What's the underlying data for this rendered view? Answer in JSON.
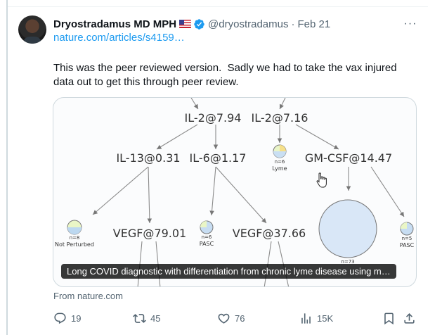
{
  "tweet": {
    "author_name": "Dryostradamus MD MPH",
    "handle": "@dryostradamus",
    "separator": "·",
    "date": "Feb 21",
    "link": "nature.com/articles/s4159…",
    "text": "This was the peer reviewed version.  Sadly we had to take the vax injured data out to get this through peer review.",
    "more_icon": "···"
  },
  "card": {
    "caption": "Long COVID diagnostic with differentiation from chronic lyme disease using m…",
    "source": "From nature.com",
    "diagram": {
      "nodes": {
        "il2_a": "IL-2@7.94",
        "il2_b": "IL-2@7.16",
        "il13": "IL-13@0.31",
        "il6": "IL-6@1.17",
        "gmcsf": "GM-CSF@14.47",
        "vegf_a": "VEGF@79.01",
        "vegf_b": "VEGF@37.66"
      },
      "leaves": {
        "lyme_n": "n=6",
        "lyme_label": "Lyme",
        "notpert_n": "n=8",
        "notpert_label": "Not Perturbed",
        "pasc1_n": "n=6",
        "pasc1_label": "PASC",
        "big_n": "n=73",
        "pasc2_n": "n=5",
        "pasc2_label": "PASC"
      }
    }
  },
  "actions": {
    "replies": "19",
    "retweets": "45",
    "likes": "76",
    "views": "15K"
  },
  "colors": {
    "accent": "#1d9bf0",
    "muted": "#536471",
    "text": "#0f1419",
    "border": "#cfd9de"
  }
}
